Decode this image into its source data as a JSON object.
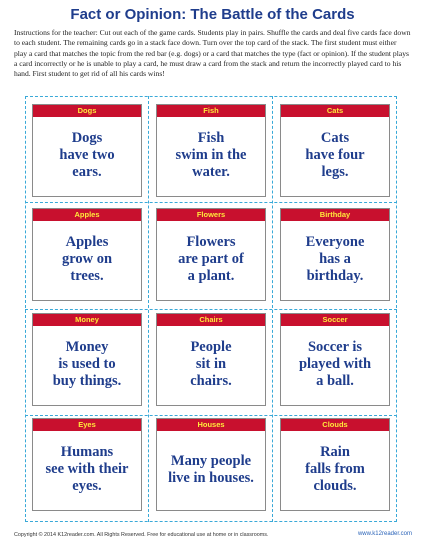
{
  "title": "Fact or Opinion: The Battle of the Cards",
  "instructions": "Instructions for the teacher: Cut out each of the game cards. Students play in pairs. Shuffle the cards and deal five cards face down to each student. The remaining cards go in a stack face down. Turn over the top card of the stack. The first student must either play a card that matches the topic from the red bar (e.g. dogs) or a card that matches the type (fact or opinion). If the student plays a card incorrectly or he is unable to play a card, he must draw a card from the stack and return the incorrectly played card to his hand. First student to get rid of all his cards wins!",
  "cards": [
    {
      "topic": "Dogs",
      "text": "Dogs\nhave two\nears."
    },
    {
      "topic": "Fish",
      "text": "Fish\nswim in the\nwater."
    },
    {
      "topic": "Cats",
      "text": "Cats\nhave four\nlegs."
    },
    {
      "topic": "Apples",
      "text": "Apples\ngrow on\ntrees."
    },
    {
      "topic": "Flowers",
      "text": "Flowers\nare part of\na plant."
    },
    {
      "topic": "Birthday",
      "text": "Everyone\nhas a\nbirthday."
    },
    {
      "topic": "Money",
      "text": "Money\nis used to\nbuy things."
    },
    {
      "topic": "Chairs",
      "text": "People\nsit in\nchairs."
    },
    {
      "topic": "Soccer",
      "text": "Soccer is\nplayed with\na ball."
    },
    {
      "topic": "Eyes",
      "text": "Humans\nsee with their\neyes."
    },
    {
      "topic": "Houses",
      "text": "Many people\nlive in houses."
    },
    {
      "topic": "Clouds",
      "text": "Rain\nfalls from\nclouds."
    }
  ],
  "footer": {
    "copyright": "Copyright © 2014  K12reader.com. All Rights Reserved. Free for educational use at home or in classrooms.",
    "url": "www.k12reader.com"
  },
  "colors": {
    "title": "#1f3d8c",
    "card_bar": "#c8102e",
    "card_bar_text": "#ffeb3b",
    "card_text": "#1f3d8c",
    "cut_lines": "#39a9d8"
  }
}
